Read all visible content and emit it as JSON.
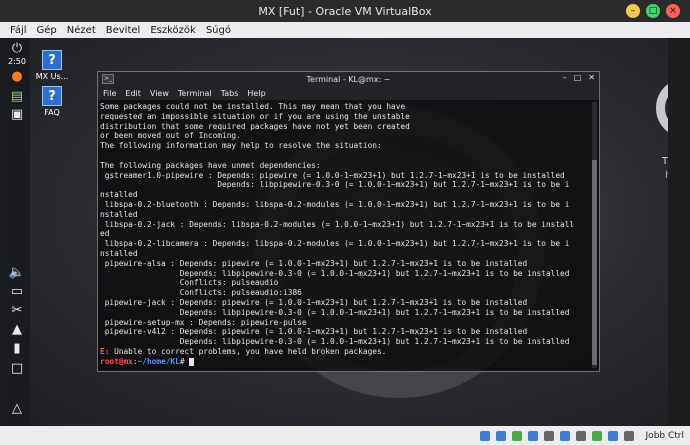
{
  "window": {
    "title": "MX [Fut] - Oracle VM VirtualBox",
    "menu": [
      "Fájl",
      "Gép",
      "Nézet",
      "Bevitel",
      "Eszközök",
      "Súgó"
    ]
  },
  "panel": {
    "clock": "2:50"
  },
  "desktop": {
    "icons": [
      {
        "label": "MX Us..."
      },
      {
        "label": "FAQ"
      }
    ]
  },
  "terminal": {
    "title": "Terminal - KL@mx: ~",
    "menu": [
      "File",
      "Edit",
      "View",
      "Terminal",
      "Tabs",
      "Help"
    ],
    "lines": [
      "Some packages could not be installed. This may mean that you have",
      "requested an impossible situation or if you are using the unstable",
      "distribution that some required packages have not yet been created",
      "or been moved out of Incoming.",
      "The following information may help to resolve the situation:",
      "",
      "The following packages have unmet dependencies:",
      " gstreamer1.0-pipewire : Depends: pipewire (= 1.0.0-1~mx23+1) but 1.2.7-1~mx23+1 is to be installed",
      "                         Depends: libpipewire-0.3-0 (= 1.0.0-1~mx23+1) but 1.2.7-1~mx23+1 is to be i",
      "nstalled",
      " libspa-0.2-bluetooth : Depends: libspa-0.2-modules (= 1.0.0-1~mx23+1) but 1.2.7-1~mx23+1 is to be i",
      "nstalled",
      " libspa-0.2-jack : Depends: libspa-0.2-modules (= 1.0.0-1~mx23+1) but 1.2.7-1~mx23+1 is to be install",
      "ed",
      " libspa-0.2-libcamera : Depends: libspa-0.2-modules (= 1.0.0-1~mx23+1) but 1.2.7-1~mx23+1 is to be i",
      "nstalled",
      " pipewire-alsa : Depends: pipewire (= 1.0.0-1~mx23+1) but 1.2.7-1~mx23+1 is to be installed",
      "                 Depends: libpipewire-0.3-0 (= 1.0.0-1~mx23+1) but 1.2.7-1~mx23+1 is to be installed",
      "                 Conflicts: pulseaudio",
      "                 Conflicts: pulseaudio:i386",
      " pipewire-jack : Depends: pipewire (= 1.0.0-1~mx23+1) but 1.2.7-1~mx23+1 is to be installed",
      "                 Depends: libpipewire-0.3-0 (= 1.0.0-1~mx23+1) but 1.2.7-1~mx23+1 is to be installed",
      " pipewire-setup-mx : Depends: pipewire-pulse",
      " pipewire-v4l2 : Depends: pipewire (= 1.0.0-1~mx23+1) but 1.2.7-1~mx23+1 is to be installed",
      "                 Depends: libpipewire-0.3-0 (= 1.0.0-1~mx23+1) but 1.2.7-1~mx23+1 is to be installed"
    ],
    "error_code": "E:",
    "error_text": " Unable to correct problems, you have held broken packages.",
    "prompt_user": "root@mx",
    "prompt_sep": ":",
    "prompt_path": "~/home/KL",
    "prompt_symbol": "#"
  },
  "statusbar": {
    "host_key": "Jobb Ctrl"
  },
  "colors": {
    "terminal_border": "#4c74b8",
    "error_red": "#ff4f4f",
    "prompt_blue": "#5f8fff"
  }
}
